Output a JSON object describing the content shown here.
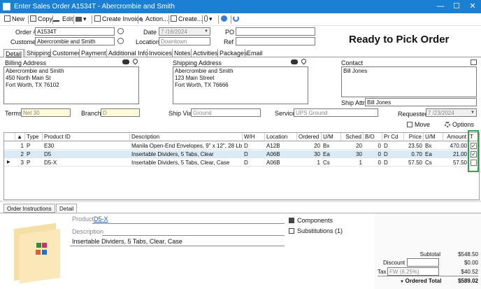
{
  "window": {
    "title": "Enter Sales Order A1534T - Abercrombie and Smith",
    "min": "—",
    "max": "☐",
    "close": "✕"
  },
  "toolbar": {
    "new": "New",
    "copy": "Copy",
    "edit": "Edit",
    "print": "▾",
    "create_invoice": "Create Invoice",
    "action": "Action...",
    "create": "Create...",
    "attach": "▾"
  },
  "header": {
    "order_label": "Order #",
    "order_value": "A1534T",
    "customer_label": "Customer",
    "customer_value": "Abercrombie and Smith",
    "date_label": "Date",
    "date_value": "7 /16/2024",
    "location_label": "Location",
    "location_value": "Downtown",
    "po_label": "PO",
    "po_value": "",
    "ref_label": "Ref",
    "ref_value": "",
    "status": "Ready to Pick Order"
  },
  "tabs": [
    "Detail",
    "Shipping",
    "Customer",
    "Payment",
    "Additional Info",
    "Invoices",
    "Notes",
    "Activities",
    "Packages",
    "Email"
  ],
  "billing": {
    "label": "Billing Address",
    "lines": [
      "Abercrombie and Smith",
      "450 North Main St",
      "Fort Worth, TX 76102"
    ]
  },
  "shipping": {
    "label": "Shipping Address",
    "lines": [
      "Abercrombie and Smith",
      "123 Main Street",
      "Fort Worth, TX 76666"
    ]
  },
  "contact": {
    "label": "Contact",
    "value": "Bill Jones",
    "ship_attn_label": "Ship Attn",
    "ship_attn_value": "Bill Jones"
  },
  "terms": {
    "label": "Terms",
    "value": "Net 30"
  },
  "branch": {
    "label": "Branch",
    "value": "D"
  },
  "ship_via": {
    "label": "Ship Via",
    "value": "Ground"
  },
  "service": {
    "label": "Service",
    "value": "UPS Ground"
  },
  "requested": {
    "label": "Requested",
    "value": "7 /23/2024"
  },
  "grid_actions": {
    "move": "Move",
    "options": "Options"
  },
  "columns": [
    "",
    "Type",
    "Product ID",
    "Description",
    "W/H",
    "Location",
    "Ordered",
    "U/M",
    "Sched",
    "B/O",
    "Pr Cd",
    "Price",
    "U/M",
    "Amount",
    "T"
  ],
  "rows": [
    {
      "num": "1",
      "type": "P",
      "product": "E30",
      "desc": "Manila Open-End Envelopes, 9\" x 12\", 28 Lb.",
      "wh": "D",
      "loc": "A12B",
      "ordered": "20",
      "um": "Bx",
      "sched": "20",
      "bo": "0",
      "prcd": "D",
      "price": "23.50",
      "um2": "Bx",
      "amount": "470.00",
      "t": "✓"
    },
    {
      "num": "2",
      "type": "P",
      "product": "D5",
      "desc": "Insertable Dividers, 5 Tabs, Clear",
      "wh": "D",
      "loc": "A06B",
      "ordered": "30",
      "um": "Ea",
      "sched": "30",
      "bo": "0",
      "prcd": "D",
      "price": "0.70",
      "um2": "Ea",
      "amount": "21.00",
      "t": "✓"
    },
    {
      "num": "3",
      "type": "P",
      "product": "D5-X",
      "desc": "Insertable Dividers, 5 Tabs, Clear, Case",
      "wh": "D",
      "loc": "A06B",
      "ordered": "1",
      "um": "Cs",
      "sched": "1",
      "bo": "0",
      "prcd": "D",
      "price": "57.50",
      "um2": "Cs",
      "amount": "57.50",
      "t": ""
    }
  ],
  "bottom_tabs": [
    "Order Instructions",
    "Detail"
  ],
  "detail": {
    "product_label": "Product",
    "product_value": "D5-X",
    "description_label": "Description",
    "description_value": "Insertable Dividers, 5 Tabs, Clear, Case",
    "components": "Components",
    "substitutions": "Substitutions (1)"
  },
  "totals": {
    "subtotal_label": "Subtotal",
    "subtotal": "$548.50",
    "discount_label": "Discount",
    "discount": "$0.00",
    "tax_label": "Tax",
    "tax_field": "FW (8.25%)",
    "tax": "$40.52",
    "ordered_total_label": "Ordered Total",
    "ordered_total": "$589.02"
  },
  "colors": {
    "title_bar": "#1b7fd4",
    "highlight": "#2aa34a",
    "selected_row": "#dbeaf7"
  }
}
